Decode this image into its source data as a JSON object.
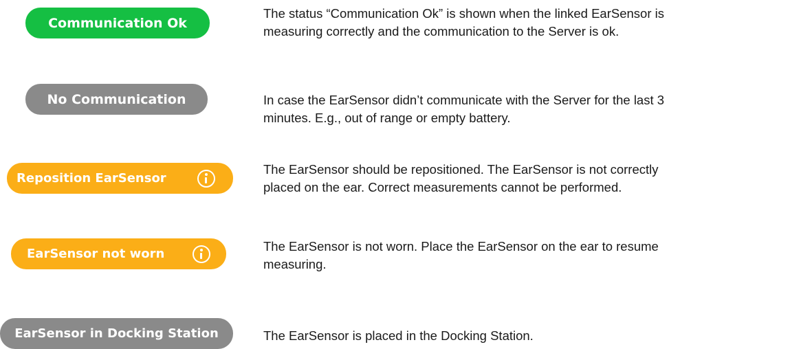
{
  "statuses": [
    {
      "badge_label": "Communication Ok",
      "badge_color": "#15bf43",
      "has_info_icon": false,
      "description_line1": "The status “Communication Ok” is shown when the linked EarSensor is",
      "description_line2": "measuring correctly and the communication to the Server is ok."
    },
    {
      "badge_label": "No Communication",
      "badge_color": "#8a8a8a",
      "has_info_icon": false,
      "description_line1": "In case the EarSensor didn’t communicate with the Server for the last 3",
      "description_line2": "minutes. E.g., out of range or empty battery."
    },
    {
      "badge_label": "Reposition EarSensor",
      "badge_color": "#fbae17",
      "has_info_icon": true,
      "icon": "info-circle-icon",
      "description_line1": "The EarSensor should be repositioned. The EarSensor is not correctly",
      "description_line2": "placed on the ear. Correct measurements cannot be performed."
    },
    {
      "badge_label": "EarSensor not worn",
      "badge_color": "#fbae17",
      "has_info_icon": true,
      "icon": "info-circle-icon",
      "description_line1": "The EarSensor is not worn. Place the EarSensor on the ear to resume",
      "description_line2": "measuring."
    },
    {
      "badge_label": "EarSensor in Docking Station",
      "badge_color": "#8a8a8a",
      "has_info_icon": false,
      "description_line1": "The EarSensor is placed in the Docking Station.",
      "description_line2": ""
    }
  ]
}
